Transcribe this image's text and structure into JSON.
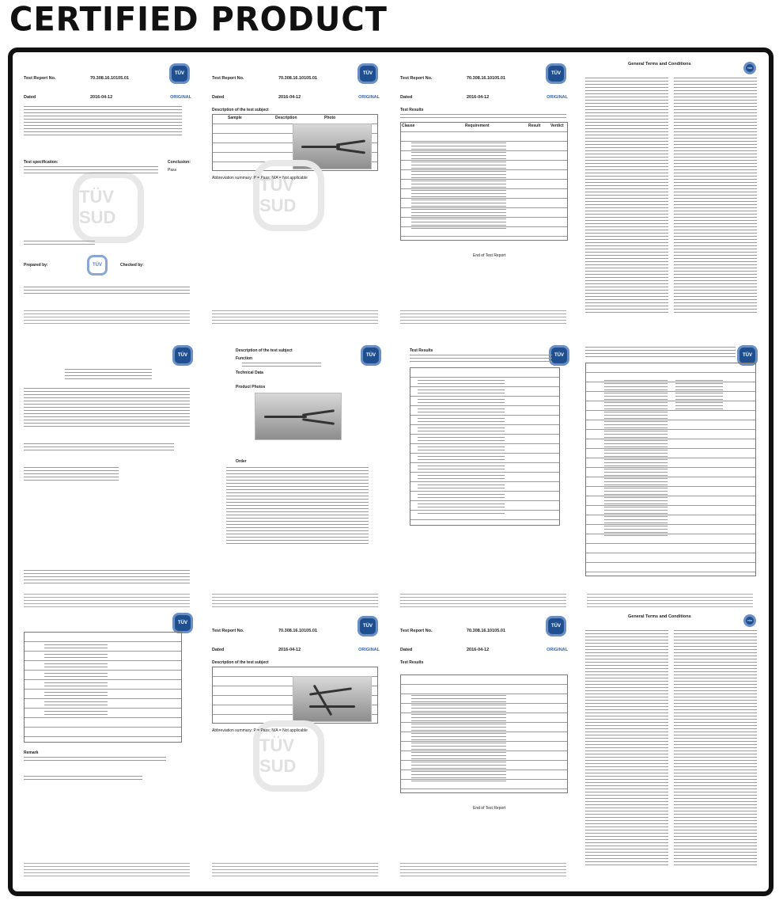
{
  "heading": "CERTIFIED PRODUCT",
  "colors": {
    "frame": "#111111",
    "logo": "#1f4f8f",
    "original_label": "#3a66a8"
  },
  "report": {
    "no_label": "Test Report No.",
    "no": "70.308.16.10105.01",
    "dated_label": "Dated",
    "date": "2016-04-12",
    "original": "ORIGINAL",
    "logo_text": "TÜV",
    "watermark": "TÜV SUD"
  },
  "pages": {
    "p1": {
      "test_spec": "Test specification:",
      "conclusion": "Conclusion:",
      "pass": "Pass",
      "prepared": "Prepared by:",
      "checked": "Checked by:"
    },
    "p2": {
      "desc": "Description of the test subject",
      "cols": [
        "Sample",
        "Description",
        "Photo"
      ],
      "abbrev": "Abbreviation summary: P = Pass; N/A = Not applicable"
    },
    "p3": {
      "results": "Test Results",
      "cols": [
        "Clause",
        "Requirement",
        "Result",
        "Verdict"
      ],
      "end": "End of Test Report"
    },
    "p4": {
      "title": "General Terms and Conditions"
    },
    "p6": {
      "s1": "Description of the test subject",
      "s11": "Function",
      "s12": "Technical Data",
      "s13": "Product Photos",
      "s2": "Order"
    },
    "p7": {
      "results": "Test Results"
    },
    "p9": {
      "remark": "Remark"
    }
  }
}
